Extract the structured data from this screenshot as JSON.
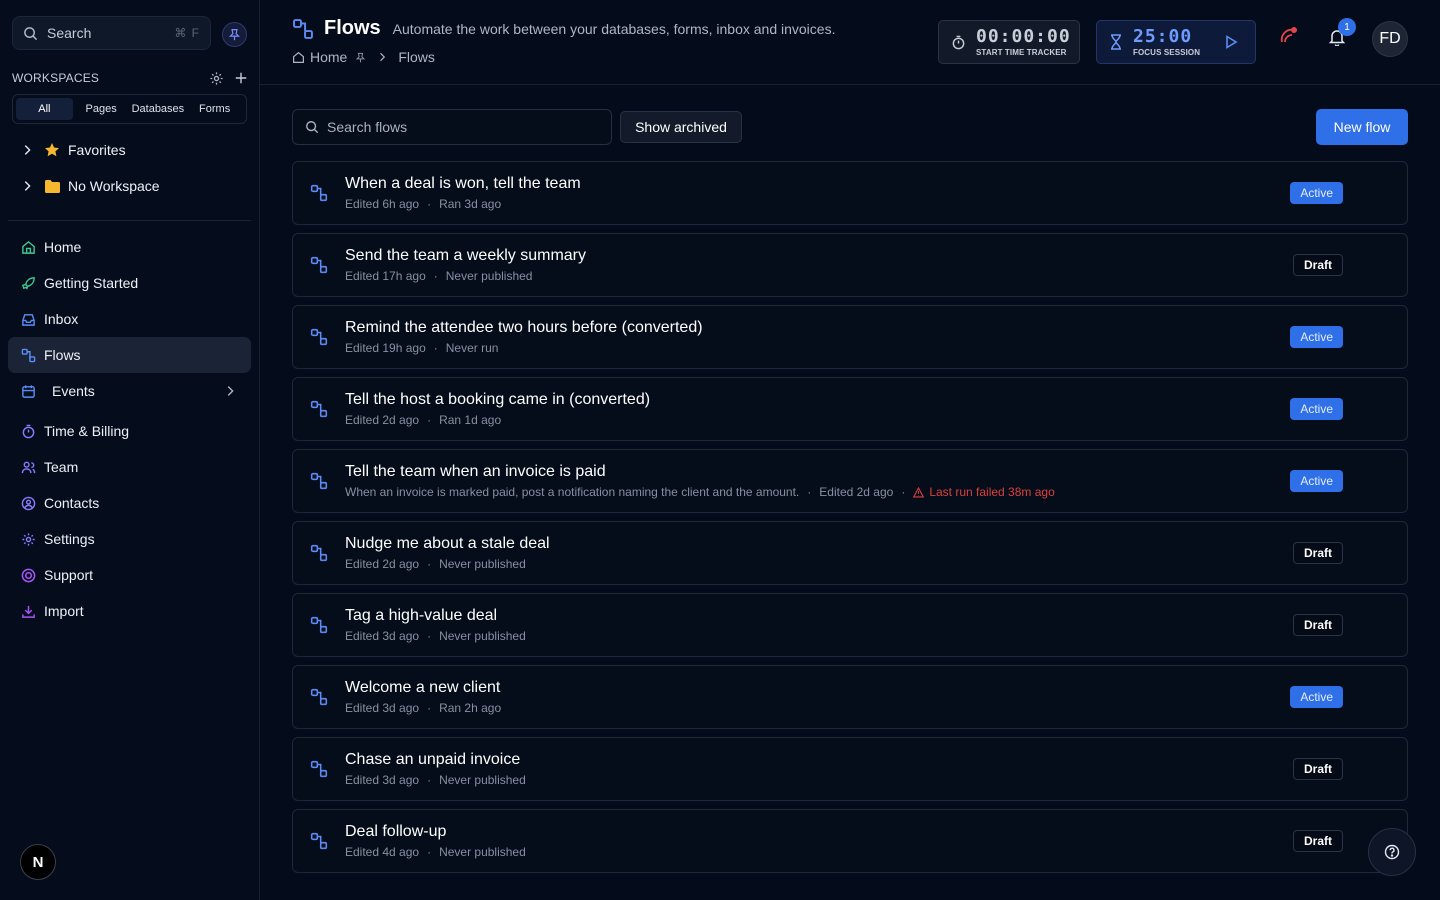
{
  "sidebar": {
    "search_label": "Search",
    "search_shortcut": "⌘ F",
    "workspaces_title": "WORKSPACES",
    "tabs": [
      "All",
      "Pages",
      "Databases",
      "Forms"
    ],
    "tree": [
      {
        "label": "Favorites",
        "icon": "star-icon"
      },
      {
        "label": "No Workspace",
        "icon": "folder-icon"
      }
    ],
    "nav": [
      {
        "label": "Home",
        "icon": "home-icon"
      },
      {
        "label": "Getting Started",
        "icon": "rocket-icon"
      },
      {
        "label": "Inbox",
        "icon": "inbox-icon"
      },
      {
        "label": "Flows",
        "icon": "flow-icon",
        "active": true
      },
      {
        "label": "Events",
        "icon": "calendar-icon"
      },
      {
        "label": "Time & Billing",
        "icon": "stopwatch-icon"
      },
      {
        "label": "Team",
        "icon": "users-icon"
      },
      {
        "label": "Contacts",
        "icon": "contact-icon"
      },
      {
        "label": "Settings",
        "icon": "gear-icon"
      },
      {
        "label": "Support",
        "icon": "lifebuoy-icon"
      },
      {
        "label": "Import",
        "icon": "download-icon"
      }
    ],
    "logo_letter": "N"
  },
  "header": {
    "title": "Flows",
    "subtitle": "Automate the work between your databases, forms, inbox and invoices.",
    "breadcrumb": [
      "Home",
      "Flows"
    ],
    "tracker": {
      "time": "00:00:00",
      "caption": "START TIME TRACKER"
    },
    "focus": {
      "time": "25:00",
      "caption": "FOCUS SESSION"
    },
    "notification_count": "1",
    "avatar_initials": "FD"
  },
  "toolbar": {
    "search_placeholder": "Search flows",
    "show_archived_label": "Show archived",
    "new_flow_label": "New flow"
  },
  "flows": [
    {
      "name": "When a deal is won, tell the team",
      "meta": [
        "Edited 6h ago",
        "Ran 3d ago"
      ],
      "status": "Active"
    },
    {
      "name": "Send the team a weekly summary",
      "meta": [
        "Edited 17h ago",
        "Never published"
      ],
      "status": "Draft"
    },
    {
      "name": "Remind the attendee two hours before (converted)",
      "meta": [
        "Edited 19h ago",
        "Never run"
      ],
      "status": "Active"
    },
    {
      "name": "Tell the host a booking came in (converted)",
      "meta": [
        "Edited 2d ago",
        "Ran 1d ago"
      ],
      "status": "Active"
    },
    {
      "name": "Tell the team when an invoice is paid",
      "meta": [
        "When an invoice is marked paid, post a notification naming the client and the amount.",
        "Edited 2d ago"
      ],
      "error": "Last run failed 38m ago",
      "status": "Active"
    },
    {
      "name": "Nudge me about a stale deal",
      "meta": [
        "Edited 2d ago",
        "Never published"
      ],
      "status": "Draft"
    },
    {
      "name": "Tag a high-value deal",
      "meta": [
        "Edited 3d ago",
        "Never published"
      ],
      "status": "Draft"
    },
    {
      "name": "Welcome a new client",
      "meta": [
        "Edited 3d ago",
        "Ran 2h ago"
      ],
      "status": "Active"
    },
    {
      "name": "Chase an unpaid invoice",
      "meta": [
        "Edited 3d ago",
        "Never published"
      ],
      "status": "Draft"
    },
    {
      "name": "Deal follow-up",
      "meta": [
        "Edited 4d ago",
        "Never published"
      ],
      "status": "Draft"
    }
  ],
  "colors": {
    "accent": "#2f6fe8",
    "background": "#040b1a",
    "error": "#d9423f",
    "favorite": "#f5b82e",
    "nav_icon": "#8b7bff"
  }
}
